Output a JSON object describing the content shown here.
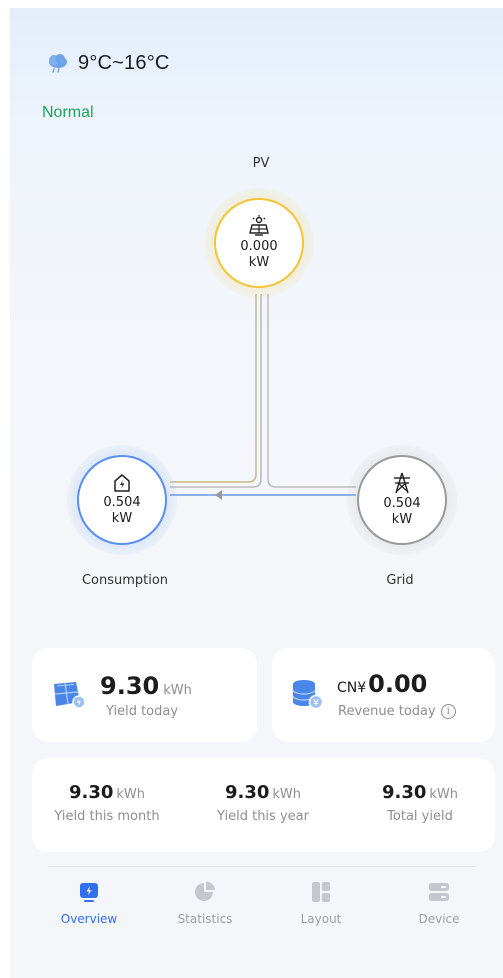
{
  "weather": {
    "icon": "cloud-rain-icon",
    "temperature_range": "9°C~16°C"
  },
  "system_status": "Normal",
  "colors": {
    "normal": "#1aa65a",
    "pv": "#f3c536",
    "consumption": "#5a8ef0",
    "grid": "#9a9a9a",
    "accent": "#2f6ff0"
  },
  "energy_flow": {
    "pv": {
      "label": "PV",
      "icon": "solar-panel-icon",
      "value": "0.000",
      "unit": "kW"
    },
    "consumption": {
      "label": "Consumption",
      "icon": "home-power-icon",
      "value": "0.504",
      "unit": "kW"
    },
    "grid": {
      "label": "Grid",
      "icon": "power-tower-icon",
      "value": "0.504",
      "unit": "kW"
    }
  },
  "cards": {
    "yield_today": {
      "value": "9.30",
      "unit": "kWh",
      "label": "Yield today"
    },
    "revenue_today": {
      "currency": "CN¥",
      "value": "0.00",
      "label": "Revenue today"
    }
  },
  "stats": [
    {
      "value": "9.30",
      "unit": "kWh",
      "label": "Yield this month"
    },
    {
      "value": "9.30",
      "unit": "kWh",
      "label": "Yield this year"
    },
    {
      "value": "9.30",
      "unit": "kWh",
      "label": "Total yield"
    }
  ],
  "tabs": [
    {
      "label": "Overview",
      "icon": "overview-icon",
      "active": true
    },
    {
      "label": "Statistics",
      "icon": "pie-chart-icon",
      "active": false
    },
    {
      "label": "Layout",
      "icon": "layout-icon",
      "active": false
    },
    {
      "label": "Device",
      "icon": "device-icon",
      "active": false
    }
  ]
}
